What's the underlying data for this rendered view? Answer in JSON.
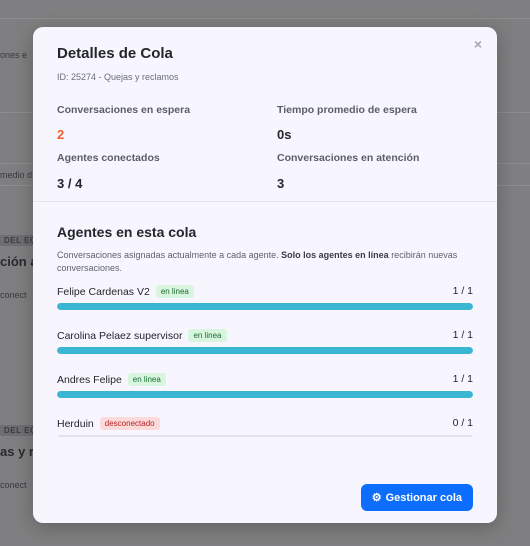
{
  "background": {
    "texts": [
      "ones e",
      "medio d",
      "conect",
      "conect"
    ],
    "tags": [
      "DEL EQ",
      "DEL EQ"
    ],
    "headings": [
      "ción a",
      "as y r"
    ]
  },
  "modal": {
    "title": "Detalles de Cola",
    "subtitle": "ID: 25274 - Quejas y reclamos",
    "close_icon": "×",
    "stats": [
      {
        "label": "Conversaciones en espera",
        "value": "2",
        "highlight": "#f2622e"
      },
      {
        "label": "Tiempo promedio de espera",
        "value": "0s"
      },
      {
        "label": "Agentes conectados",
        "value": "3 / 4"
      },
      {
        "label": "Conversaciones en atención",
        "value": "3"
      }
    ],
    "agents_section": {
      "title": "Agentes en esta cola",
      "description_prefix": "Conversaciones asignadas actualmente a cada agente. ",
      "description_bold": "Solo los agentes en línea",
      "description_suffix": " recibirán nuevas conversaciones."
    },
    "agents": [
      {
        "name": "Felipe Cardenas V2",
        "status": "en linea",
        "online": true,
        "count": "1 / 1",
        "load": 1.0
      },
      {
        "name": "Carolina Pelaez supervisor",
        "status": "en linea",
        "online": true,
        "count": "1 / 1",
        "load": 1.0
      },
      {
        "name": "Andres Felipe",
        "status": "en linea",
        "online": true,
        "count": "1 / 1",
        "load": 1.0
      },
      {
        "name": "Herduin",
        "status": "desconectado",
        "online": false,
        "count": "0 / 1",
        "load": 0.0
      }
    ],
    "manage_button": {
      "icon": "gear-icon",
      "label": "Gestionar cola",
      "color": "#0d6efd"
    }
  }
}
